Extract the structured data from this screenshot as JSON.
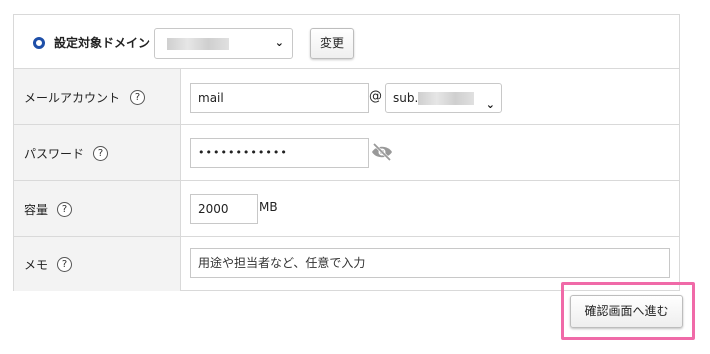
{
  "domain": {
    "label": "設定対象ドメイン",
    "change_button": "変更"
  },
  "rows": {
    "mail_account": {
      "label": "メールアカウント",
      "help": "?",
      "value": "mail",
      "at": "@",
      "domain_prefix": "sub."
    },
    "password": {
      "label": "パスワード",
      "help": "?",
      "value": "••••••••••••"
    },
    "capacity": {
      "label": "容量",
      "help": "?",
      "value": "2000",
      "unit": "MB"
    },
    "memo": {
      "label": "メモ",
      "help": "?",
      "placeholder": "用途や担当者など、任意で入力"
    }
  },
  "confirm_button": "確認画面へ進む",
  "colors": {
    "radio_accent": "#1e4fa8",
    "highlight_frame": "#f06aa8",
    "label_cell_bg": "#f3f3f3"
  }
}
